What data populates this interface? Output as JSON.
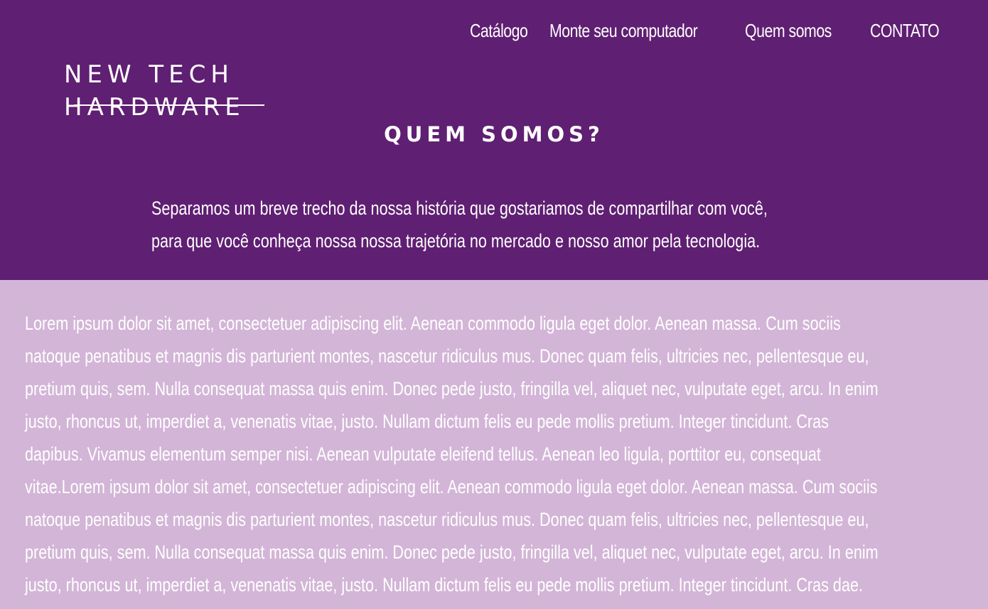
{
  "nav": {
    "items": [
      {
        "label": "Catálogo"
      },
      {
        "label": "Monte seu computador"
      },
      {
        "label": "Quem somos"
      },
      {
        "label": "CONTATO"
      }
    ]
  },
  "logo": {
    "line1": "NEW TECH",
    "line2": "HARDWARE"
  },
  "hero": {
    "title": "QUEM SOMOS?",
    "intro_lines": [
      "Separamos um breve trecho da nossa história que gostariamos de compartilhar com você,",
      "para que você conheça nossa nossa trajetória no mercado e nosso amor pela tecnologia."
    ]
  },
  "content": {
    "lines": [
      "Lorem ipsum dolor sit amet, consectetuer adipiscing elit. Aenean commodo ligula eget dolor. Aenean massa. Cum sociis",
      "natoque penatibus et magnis dis parturient montes, nascetur ridiculus mus. Donec quam felis, ultricies nec, pellentesque eu,",
      "pretium quis, sem. Nulla consequat massa quis enim. Donec pede justo, fringilla vel, aliquet nec, vulputate eget, arcu. In enim",
      "justo, rhoncus ut, imperdiet a, venenatis vitae, justo. Nullam dictum felis eu pede mollis pretium. Integer tincidunt. Cras",
      "dapibus. Vivamus elementum semper nisi. Aenean vulputate eleifend tellus. Aenean leo ligula, porttitor eu, consequat",
      "vitae.Lorem ipsum dolor sit amet, consectetuer adipiscing elit. Aenean commodo ligula eget dolor. Aenean massa. Cum sociis",
      "natoque penatibus et magnis dis parturient montes, nascetur ridiculus mus. Donec quam felis, ultricies nec, pellentesque eu,",
      "pretium quis, sem. Nulla consequat massa quis enim. Donec pede justo, fringilla vel, aliquet nec, vulputate eget, arcu. In enim",
      "justo, rhoncus ut, imperdiet a, venenatis vitae, justo. Nullam dictum felis eu pede mollis pretium. Integer tincidunt. Cras dae."
    ]
  },
  "colors": {
    "header_bg": "#5f1f72",
    "content_bg": "#d3b5d7",
    "text": "#ffffff"
  }
}
